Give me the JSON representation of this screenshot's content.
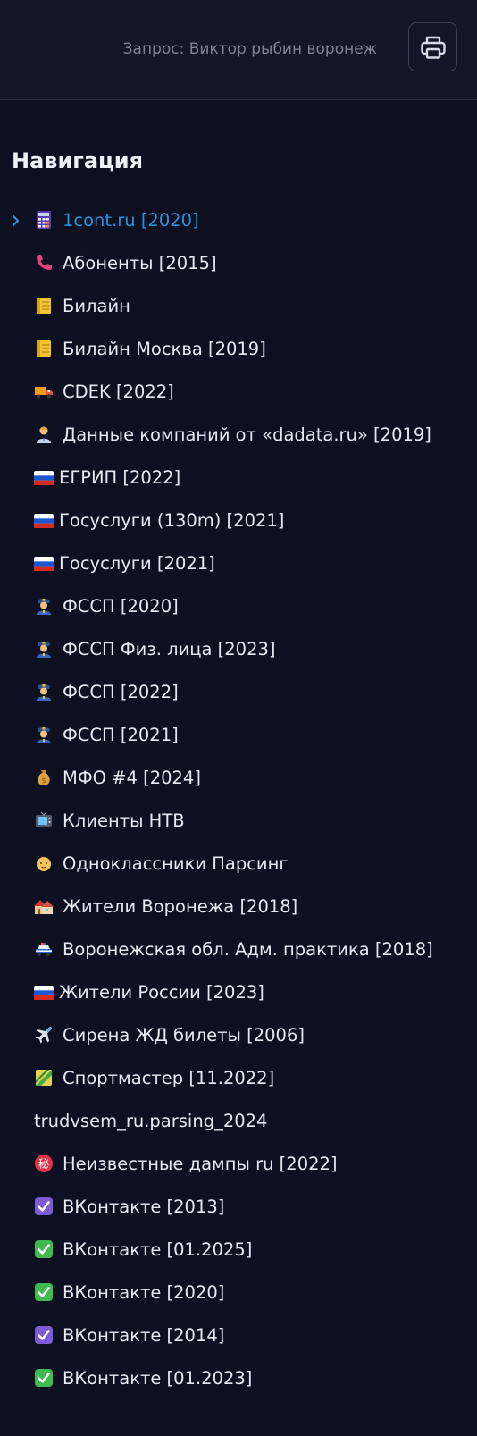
{
  "header": {
    "query_text": "Запрос: Виктор рыбин воронеж",
    "print_icon": "printer-icon"
  },
  "navigation": {
    "title": "Навигация",
    "items": [
      {
        "label": "1cont.ru [2020]",
        "icon": "abacus-icon",
        "active": true
      },
      {
        "label": "Абоненты [2015]",
        "icon": "telephone-receiver-icon"
      },
      {
        "label": "Билайн",
        "icon": "ledger-icon"
      },
      {
        "label": "Билайн Москва [2019]",
        "icon": "ledger-icon"
      },
      {
        "label": "CDEK [2022]",
        "icon": "delivery-truck-icon"
      },
      {
        "label": "Данные компаний от «dadata.ru» [2019]",
        "icon": "office-worker-icon"
      },
      {
        "label": "ЕГРИП [2022]",
        "icon": "russia-flag-icon"
      },
      {
        "label": "Госуслуги (130m) [2021]",
        "icon": "russia-flag-icon"
      },
      {
        "label": "Госуслуги [2021]",
        "icon": "russia-flag-icon"
      },
      {
        "label": "ФССП [2020]",
        "icon": "police-officer-icon"
      },
      {
        "label": "ФССП Физ. лица [2023]",
        "icon": "police-officer-icon"
      },
      {
        "label": "ФССП [2022]",
        "icon": "police-officer-icon"
      },
      {
        "label": "ФССП [2021]",
        "icon": "police-officer-icon"
      },
      {
        "label": "МФО #4 [2024]",
        "icon": "money-bag-icon"
      },
      {
        "label": "Клиенты НТВ",
        "icon": "television-icon"
      },
      {
        "label": "Одноклассники Парсинг",
        "icon": "baby-face-icon"
      },
      {
        "label": "Жители Воронежа [2018]",
        "icon": "houses-icon"
      },
      {
        "label": "Воронежская обл. Адм. практика [2018]",
        "icon": "police-car-icon"
      },
      {
        "label": "Жители России [2023]",
        "icon": "russia-flag-icon"
      },
      {
        "label": "Сирена ЖД билеты [2006]",
        "icon": "airplane-icon"
      },
      {
        "label": "Спортмастер [11.2022]",
        "icon": "sash-icon"
      },
      {
        "label": "trudvsem_ru.parsing_2024",
        "icon": ""
      },
      {
        "label": "Неизвестные дампы ru [2022]",
        "icon": "secret-ideograph-icon"
      },
      {
        "label": "ВКонтакте [2013]",
        "icon": "check-box-purple-icon"
      },
      {
        "label": "ВКонтакте [01.2025]",
        "icon": "check-mark-green-icon"
      },
      {
        "label": "ВКонтакте [2020]",
        "icon": "check-mark-green-icon"
      },
      {
        "label": "ВКонтакте [2014]",
        "icon": "check-box-purple-icon"
      },
      {
        "label": "ВКонтакте [01.2023]",
        "icon": "check-mark-green-icon"
      }
    ]
  },
  "colors": {
    "background": "#0c1020",
    "header_background": "#111729",
    "active_link": "#2d8fd8",
    "text": "#e6e9f0",
    "muted_text": "#7d8497"
  }
}
